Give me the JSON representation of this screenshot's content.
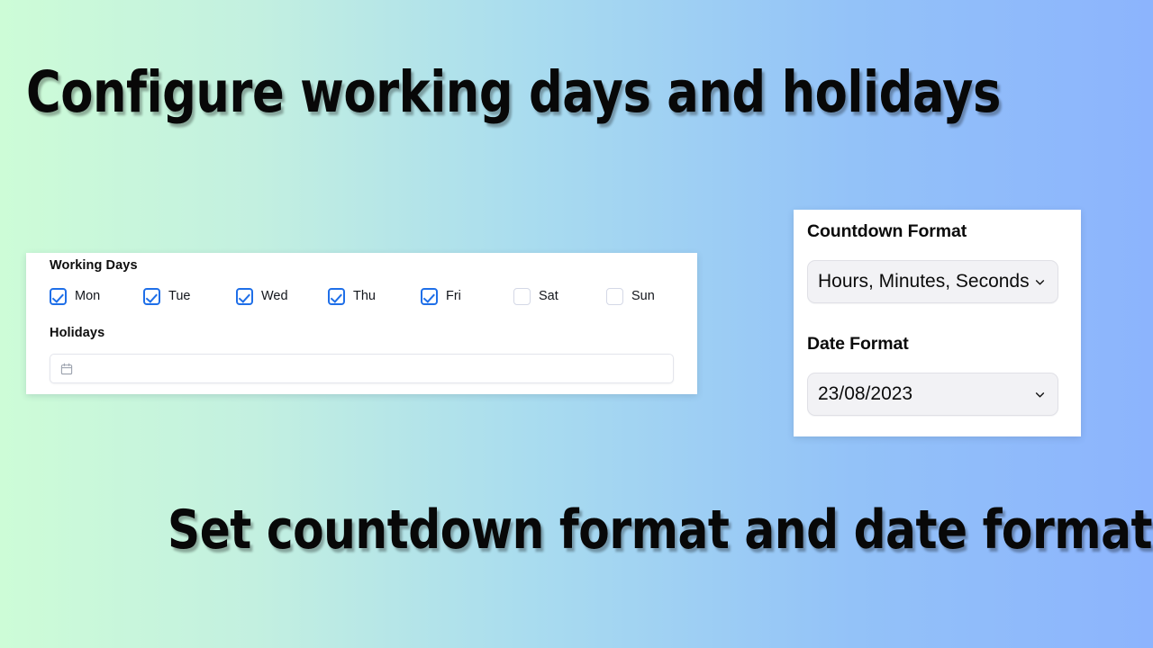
{
  "background": {
    "gradient_from": "#cdfcd7",
    "gradient_to": "#8cb4fd",
    "direction": "left-to-right"
  },
  "headlines": {
    "top": "Configure working days and holidays",
    "bottom": "Set countdown format and date format"
  },
  "working_days_panel": {
    "working_days_label": "Working Days",
    "days": [
      {
        "label": "Mon",
        "checked": true
      },
      {
        "label": "Tue",
        "checked": true
      },
      {
        "label": "Wed",
        "checked": true
      },
      {
        "label": "Thu",
        "checked": true
      },
      {
        "label": "Fri",
        "checked": true
      },
      {
        "label": "Sat",
        "checked": false
      },
      {
        "label": "Sun",
        "checked": false
      }
    ],
    "holidays_label": "Holidays",
    "holidays_input": {
      "value": "",
      "placeholder": "",
      "icon": "calendar-icon"
    },
    "checkbox_accent": "#1f6fe8",
    "checkbox_empty_border": "#d4d8e6"
  },
  "format_panel": {
    "countdown": {
      "title": "Countdown Format",
      "selected": "Hours, Minutes, Seconds",
      "icon": "chevron-down-icon"
    },
    "date": {
      "title": "Date Format",
      "selected": "23/08/2023",
      "icon": "chevron-down-icon"
    },
    "select_background": "#f2f2f5"
  }
}
